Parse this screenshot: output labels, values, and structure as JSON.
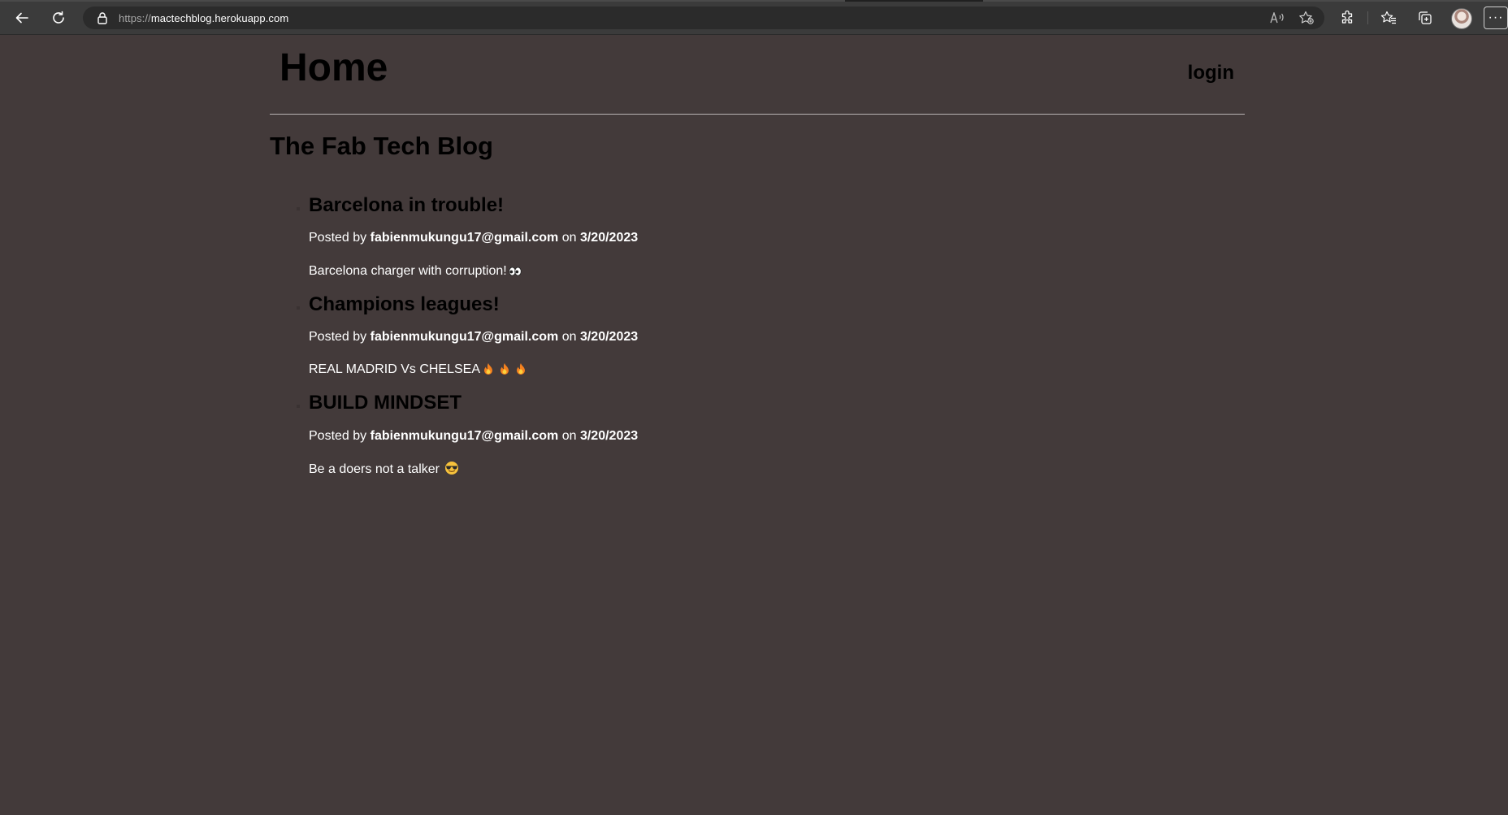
{
  "browser": {
    "url_scheme": "https://",
    "url_host": "mactechblog.herokuapp.com",
    "icons": {
      "back": "back-arrow-icon",
      "refresh": "refresh-icon",
      "lock": "lock-icon",
      "read_aloud": "read-aloud-icon",
      "add_favorite": "add-favorite-icon",
      "extensions": "extensions-icon",
      "favorites": "favorites-icon",
      "collections": "collections-icon",
      "profile": "profile-avatar",
      "more": "more-icon"
    },
    "more_label": "···"
  },
  "header": {
    "title": "Home",
    "login_label": "login"
  },
  "blog": {
    "title": "The Fab Tech Blog"
  },
  "posts": [
    {
      "title": "Barcelona in trouble!",
      "posted_by_prefix": "Posted by",
      "author": "fabienmukungu17@gmail.com",
      "on_label": "on",
      "date": "3/20/2023",
      "body": "Barcelona charger with corruption!",
      "emoji": [
        "eyes-emoji"
      ]
    },
    {
      "title": "Champions leagues!",
      "posted_by_prefix": "Posted by",
      "author": "fabienmukungu17@gmail.com",
      "on_label": "on",
      "date": "3/20/2023",
      "body": "REAL MADRID Vs CHELSEA",
      "emoji": [
        "fire-emoji",
        "fire-emoji",
        "fire-emoji"
      ]
    },
    {
      "title": "BUILD MINDSET",
      "posted_by_prefix": "Posted by",
      "author": "fabienmukungu17@gmail.com",
      "on_label": "on",
      "date": "3/20/2023",
      "body": "Be a doers not a talker",
      "emoji": [
        "sunglasses-face-emoji"
      ]
    }
  ],
  "colors": {
    "page_background": "#433a3a",
    "chrome_background": "#3b3b3b",
    "address_bar": "#2b2b2b",
    "heading_text": "#000000",
    "body_text": "#ffffff",
    "divider": "#b9b3b3"
  }
}
